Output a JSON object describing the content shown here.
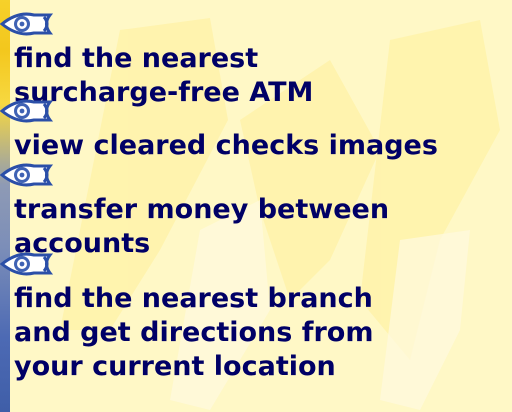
{
  "slide": {
    "items": [
      {
        "lines": [
          "find the nearest",
          "surcharge-free ATM"
        ],
        "icon": "eye-bullet-icon"
      },
      {
        "lines": [
          "view cleared checks images"
        ],
        "icon": "eye-bullet-icon"
      },
      {
        "lines": [
          "transfer money between",
          "accounts"
        ],
        "icon": "eye-bullet-icon"
      },
      {
        "lines": [
          "find the nearest branch",
          "and get directions from",
          "your current location"
        ],
        "icon": "eye-bullet-icon"
      }
    ]
  },
  "colors": {
    "background": "#fff8c6",
    "text": "#000066",
    "bullet_outline": "#2b4fa8",
    "edge_top": "#f3c71d",
    "edge_bottom": "#3f5ea8"
  }
}
